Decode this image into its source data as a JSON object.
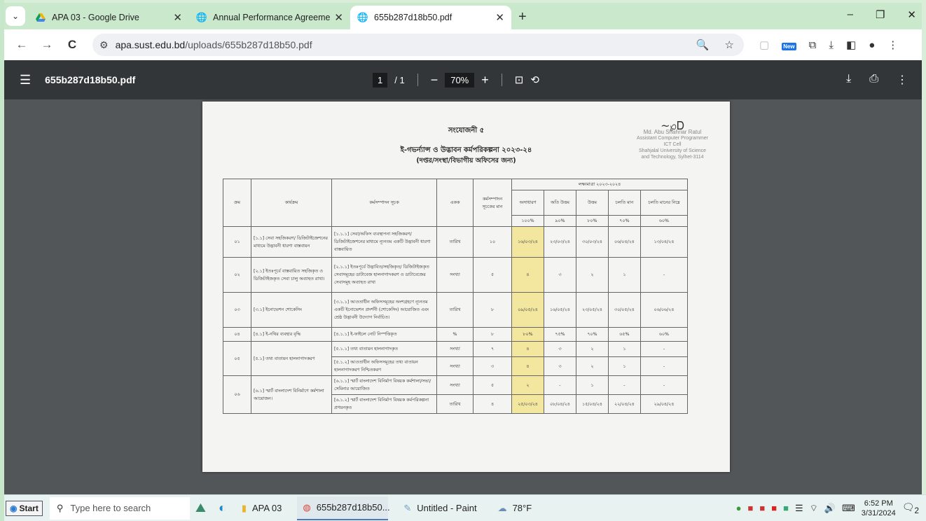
{
  "tabs": [
    {
      "title": "APA 03 - Google Drive",
      "icon": "google-drive-icon"
    },
    {
      "title": "Annual Performance Agreement",
      "icon": "globe-icon"
    },
    {
      "title": "655b287d18b50.pdf",
      "icon": "globe-icon",
      "active": true
    }
  ],
  "window": {
    "minimize": "–",
    "maximize": "❐",
    "close": "✕"
  },
  "address": {
    "host": "apa.sust.edu.bd",
    "path": "/uploads/655b287d18b50.pdf"
  },
  "pdf_toolbar": {
    "filename": "655b287d18b50.pdf",
    "page_current": "1",
    "page_total": "/ 1",
    "zoom": "70%"
  },
  "document": {
    "heading1": "সংযোজনী ৫",
    "heading2": "ই-গভর্ন্যান্স ও উদ্ভাবন কর্মপরিকল্পনা ২০২৩-২৪",
    "heading3": "(দপ্তর/সংস্থা/বিভাগীয় অফিসের জন্য)",
    "signature": {
      "name": "Md. Abu Shahriar Ratul",
      "title": "Assistant Computer Programmer",
      "dept": "ICT Cell",
      "org": "Shahjalal University of Science",
      "org2": "and Technology, Sylhet-3114"
    },
    "headers": {
      "no": "ক্রম",
      "activity": "কার্যক্রম",
      "indicator": "কর্মসম্পাদন সূচক",
      "unit": "একক",
      "weight": "কর্মসম্পাদন সূচকের মান",
      "target_group": "লক্ষ্যমাত্রা ২০২৩-২০২৪",
      "targets": [
        "অসাধারণ",
        "অতি উত্তম",
        "উত্তম",
        "চলতি মান",
        "চলতি মানের নিম্নে"
      ],
      "percents": [
        "১০০%",
        "৯০%",
        "৮০%",
        "৭০%",
        "৬০%"
      ]
    },
    "rows": [
      {
        "no": "০১",
        "activity": "[১.১] সেবা সহজিকরণ/ ডিজিটাইজেশনের মাধ্যমে উদ্ভাবনী ধারণা বাস্তবায়ন",
        "indicator": "[১.১.১] সেবা/অফিস ব্যবস্থাপনা সহজিকরণ/ডিজিটাইজেশনের মাধ্যমে ন্যূনতম একটি উদ্ভাবনী ধারণা বাস্তবায়িত",
        "unit": "তারিখ",
        "weight": "১০",
        "t": [
          "১৬/০৩/২৪",
          "২৩/০৩/২৪",
          "৩০/০৩/২৪",
          "০৬/০৪/২৪",
          "১৩/০৪/২৪"
        ]
      },
      {
        "no": "০২",
        "activity": "[২.১] ইতঃপূর্বে বাস্তবায়িত সহজিকৃত ও ডিজিটাইজকৃত সেবা চালু অব্যাহত রাখা।",
        "indicator": "[২.১.১] ইতঃপূর্বে উদ্ভাবিত/সহজিকৃত/ ডিজিটাইজকৃত সেবাসমূহের ডাটাবেজ হালনাগাদকরণ ও ডাটাবেজের সেবাসমূহ অব্যাহত রাখা",
        "unit": "সংখ্যা",
        "weight": "৫",
        "t": [
          "৪",
          "৩",
          "২",
          "১",
          "-"
        ]
      },
      {
        "no": "০৩",
        "activity": "[৩.১] ইনোভেশন শোকেসিং",
        "indicator": "[৩.১.১] আওতাধীন অফিসসমূহের অংশগ্রহণে ন্যূনতম একটি ইনোভেশন প্রদর্শনী (শোকেসিং) আয়োজিত এবং শ্রেষ্ঠ উদ্ভাবনী উদ্যোগ নির্বাচিত।",
        "unit": "তারিখ",
        "weight": "৮",
        "t": [
          "০৯/০৫/২৪",
          "১৬/০৫/২৪",
          "২৩/০৫/২৪",
          "৩০/০৫/২৪",
          "০৬/০৬/২৪"
        ]
      },
      {
        "no": "০৪",
        "activity": "[৪.১] ই-নথির ব্যবহার বৃদ্ধি",
        "indicator": "[৪.১.১] ই-ফাইলে নোট নিস্পত্তিকৃত",
        "unit": "%",
        "weight": "৮",
        "t": [
          "৮০%",
          "৭৫%",
          "৭০%",
          "৬৫%",
          "৬০%"
        ]
      },
      {
        "no": "০৫",
        "activity": "[৫.১] তথ্য বাতায়ন হালনাগাদকরণ",
        "indicator": "[৫.১.১] তথ্য বাতায়ন হালনাগাদকৃত",
        "unit": "সংখ্যা",
        "weight": "৭",
        "t": [
          "৪",
          "৩",
          "২",
          "১",
          "-"
        ]
      },
      {
        "no": "",
        "activity": "",
        "indicator": "[৫.১.২] আওতাধীন অফিসসমূহের তথ্য বাতায়ন হালনাগাদকরণ নিশ্চিতকরণ",
        "unit": "সংখ্যা",
        "weight": "৩",
        "t": [
          "৪",
          "৩",
          "২",
          "১",
          "-"
        ]
      },
      {
        "no": "০৬",
        "activity": "[৬.১] স্মার্ট বাংলাদেশ বিনির্মাণে কর্মশালা আয়োজন।",
        "indicator": "[৬.১.১] স্মার্ট বাংলাদেশ বিনির্মাণ বিষয়ক কর্মশালা/সভা/সেমিনার আয়োজিত",
        "unit": "সংখ্যা",
        "weight": "৫",
        "t": [
          "২",
          "-",
          "১",
          "-",
          "-"
        ]
      },
      {
        "no": "",
        "activity": "",
        "indicator": "[৬.১.২] স্মার্ট বাংলাদেশ বিনির্মাণ বিষয়ক কর্মপরিকল্পনা প্রণয়নকৃত",
        "unit": "তারিখ",
        "weight": "৪",
        "t": [
          "২৫/০৩/২৪",
          "০৮/০৪/২৪",
          "১৫/০৪/২৪",
          "২২/০৪/২৪",
          "২৯/০৪/২৪"
        ]
      }
    ]
  },
  "taskbar": {
    "start": "Start",
    "search_placeholder": "Type here to search",
    "items": [
      {
        "label": "APA 03",
        "icon": "folder-icon"
      },
      {
        "label": "655b287d18b50...",
        "icon": "chrome-icon",
        "active": true
      },
      {
        "label": "Untitled - Paint",
        "icon": "paint-icon"
      }
    ],
    "weather": "78°F",
    "time": "6:52 PM",
    "date": "3/31/2024",
    "notifications": "2"
  }
}
